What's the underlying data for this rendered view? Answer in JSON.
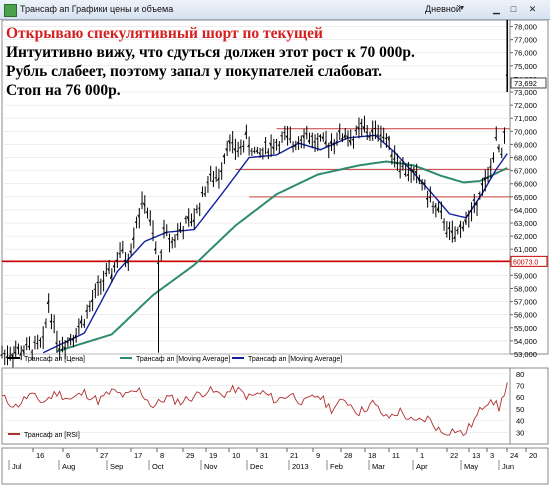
{
  "window": {
    "title": "Трансаф ап Графики цены и объема",
    "period": "Дневной"
  },
  "annotation": {
    "title": "Открываю спекулятивный шорт по текущей",
    "lines": [
      "Интуитивно вижу, что сдуться должен этот рост к 70 000р.",
      "Рубль слабеет, поэтому запал у покупателей слабоват.",
      "Стоп на 76 000р."
    ]
  },
  "price_panel": {
    "y_ticks": [
      "78,000",
      "77,000",
      "76,000",
      "75,000",
      "74,000",
      "73,000",
      "72,000",
      "71,000",
      "70,000",
      "69,000",
      "68,000",
      "67,000",
      "66,000",
      "65,000",
      "64,000",
      "63,000",
      "62,000",
      "61,000",
      "60,000",
      "59,000",
      "58,000",
      "57,000",
      "56,000",
      "55,000",
      "54,000",
      "53,000"
    ],
    "last_price_label": "73,692",
    "level_label": "60073.0",
    "legend": [
      "Трансаф ап [Цена]",
      "Трансаф ап [Moving Average]",
      "Трансаф ап [Moving Average]"
    ],
    "colors": {
      "price": "#000000",
      "ma_long": "#2e8b72",
      "ma_short": "#1020a0",
      "levels": "#c83c3c",
      "support": "#cc0000"
    }
  },
  "rsi_panel": {
    "y_ticks": [
      "80",
      "70",
      "60",
      "50",
      "40",
      "30"
    ],
    "legend": "Трансаф ап [RSI]",
    "color": "#b03030"
  },
  "x_axis": {
    "day_labels": [
      "16",
      "6",
      "27",
      "17",
      "8",
      "29",
      "19",
      "10",
      "31",
      "21",
      "9",
      "28",
      "18",
      "11",
      "1",
      "22",
      "13",
      "3",
      "24",
      "20",
      "Jun"
    ],
    "month_labels": [
      "Jul",
      "Aug",
      "Sep",
      "Oct",
      "Nov",
      "Dec",
      "2013",
      "Feb",
      "Mar",
      "Apr",
      "May",
      "Jun"
    ]
  },
  "chart_data": {
    "type": "line",
    "title": "",
    "xlabel": "",
    "ylabel": "",
    "ylim": [
      53000,
      78500
    ],
    "series": [
      {
        "name": "Трансаф ап [Цена]",
        "style": "ohlc",
        "color": "#000000",
        "anchors": [
          [
            0,
            53000
          ],
          [
            8,
            53100
          ],
          [
            16,
            53300
          ],
          [
            24,
            53500
          ],
          [
            30,
            53800
          ],
          [
            34,
            57000
          ],
          [
            38,
            55000
          ],
          [
            42,
            53600
          ],
          [
            48,
            54000
          ],
          [
            56,
            55000
          ],
          [
            64,
            56500
          ],
          [
            72,
            58500
          ],
          [
            80,
            59200
          ],
          [
            86,
            60800
          ],
          [
            92,
            60300
          ],
          [
            98,
            63200
          ],
          [
            104,
            64700
          ],
          [
            110,
            62100
          ],
          [
            114,
            59700
          ],
          [
            118,
            62300
          ],
          [
            124,
            61600
          ],
          [
            130,
            62500
          ],
          [
            140,
            63400
          ],
          [
            150,
            66200
          ],
          [
            158,
            66600
          ],
          [
            164,
            69100
          ],
          [
            172,
            68500
          ],
          [
            178,
            69400
          ],
          [
            186,
            68100
          ],
          [
            192,
            68700
          ],
          [
            200,
            69100
          ],
          [
            206,
            69500
          ],
          [
            212,
            69000
          ],
          [
            220,
            69900
          ],
          [
            228,
            69200
          ],
          [
            236,
            69000
          ],
          [
            244,
            69500
          ],
          [
            250,
            69800
          ],
          [
            256,
            69400
          ],
          [
            262,
            70300
          ],
          [
            268,
            69800
          ],
          [
            276,
            70000
          ],
          [
            282,
            69000
          ],
          [
            290,
            67400
          ],
          [
            298,
            66800
          ],
          [
            306,
            66100
          ],
          [
            314,
            64300
          ],
          [
            322,
            63200
          ],
          [
            326,
            62200
          ],
          [
            330,
            61800
          ],
          [
            336,
            63100
          ],
          [
            342,
            63600
          ],
          [
            348,
            65500
          ],
          [
            354,
            66300
          ],
          [
            360,
            69200
          ],
          [
            364,
            68000
          ],
          [
            366,
            69700
          ],
          [
            368,
            73700
          ]
        ]
      },
      {
        "name": "Трансаф ап [Moving Average]",
        "kind": "long",
        "color": "#2e8b72",
        "anchors": [
          [
            40,
            53200
          ],
          [
            80,
            54500
          ],
          [
            110,
            57500
          ],
          [
            140,
            59800
          ],
          [
            170,
            62800
          ],
          [
            200,
            65200
          ],
          [
            230,
            66700
          ],
          [
            260,
            67400
          ],
          [
            280,
            67700
          ],
          [
            300,
            67400
          ],
          [
            320,
            66600
          ],
          [
            336,
            66100
          ],
          [
            348,
            66200
          ],
          [
            360,
            66800
          ],
          [
            368,
            67200
          ]
        ]
      },
      {
        "name": "Трансаф ап [Moving Average]",
        "kind": "short",
        "color": "#1020a0",
        "anchors": [
          [
            30,
            53100
          ],
          [
            60,
            54600
          ],
          [
            84,
            59300
          ],
          [
            104,
            61600
          ],
          [
            120,
            62300
          ],
          [
            140,
            62500
          ],
          [
            160,
            65200
          ],
          [
            180,
            68000
          ],
          [
            200,
            68200
          ],
          [
            216,
            69100
          ],
          [
            232,
            68600
          ],
          [
            252,
            69500
          ],
          [
            272,
            69700
          ],
          [
            286,
            68400
          ],
          [
            300,
            66800
          ],
          [
            312,
            65400
          ],
          [
            326,
            63700
          ],
          [
            338,
            63400
          ],
          [
            350,
            65300
          ],
          [
            360,
            67100
          ],
          [
            368,
            68300
          ]
        ]
      }
    ],
    "vertical_spike": {
      "index": 368,
      "low": 73000,
      "high": 79000
    },
    "horizontal_levels": [
      {
        "value": 70200,
        "from_index": 200,
        "to_index": 370,
        "style": "thin"
      },
      {
        "value": 67100,
        "from_index": 170,
        "to_index": 370,
        "style": "thin"
      },
      {
        "value": 65000,
        "from_index": 180,
        "to_index": 370,
        "style": "thin"
      },
      {
        "value": 60073,
        "from_index": 0,
        "to_index": 370,
        "style": "thick"
      }
    ],
    "rsi": {
      "ylim": [
        20,
        85
      ],
      "anchors": [
        [
          0,
          60
        ],
        [
          10,
          52
        ],
        [
          20,
          62
        ],
        [
          30,
          56
        ],
        [
          40,
          64
        ],
        [
          50,
          58
        ],
        [
          60,
          64
        ],
        [
          70,
          57
        ],
        [
          80,
          65
        ],
        [
          90,
          61
        ],
        [
          100,
          66
        ],
        [
          110,
          52
        ],
        [
          120,
          60
        ],
        [
          130,
          56
        ],
        [
          140,
          61
        ],
        [
          150,
          66
        ],
        [
          160,
          62
        ],
        [
          170,
          67
        ],
        [
          180,
          60
        ],
        [
          190,
          64
        ],
        [
          200,
          57
        ],
        [
          210,
          63
        ],
        [
          220,
          55
        ],
        [
          230,
          62
        ],
        [
          240,
          50
        ],
        [
          250,
          58
        ],
        [
          260,
          47
        ],
        [
          270,
          55
        ],
        [
          280,
          42
        ],
        [
          290,
          48
        ],
        [
          300,
          38
        ],
        [
          310,
          42
        ],
        [
          320,
          30
        ],
        [
          330,
          32
        ],
        [
          336,
          28
        ],
        [
          344,
          40
        ],
        [
          350,
          52
        ],
        [
          356,
          60
        ],
        [
          362,
          50
        ],
        [
          368,
          72
        ]
      ]
    }
  }
}
